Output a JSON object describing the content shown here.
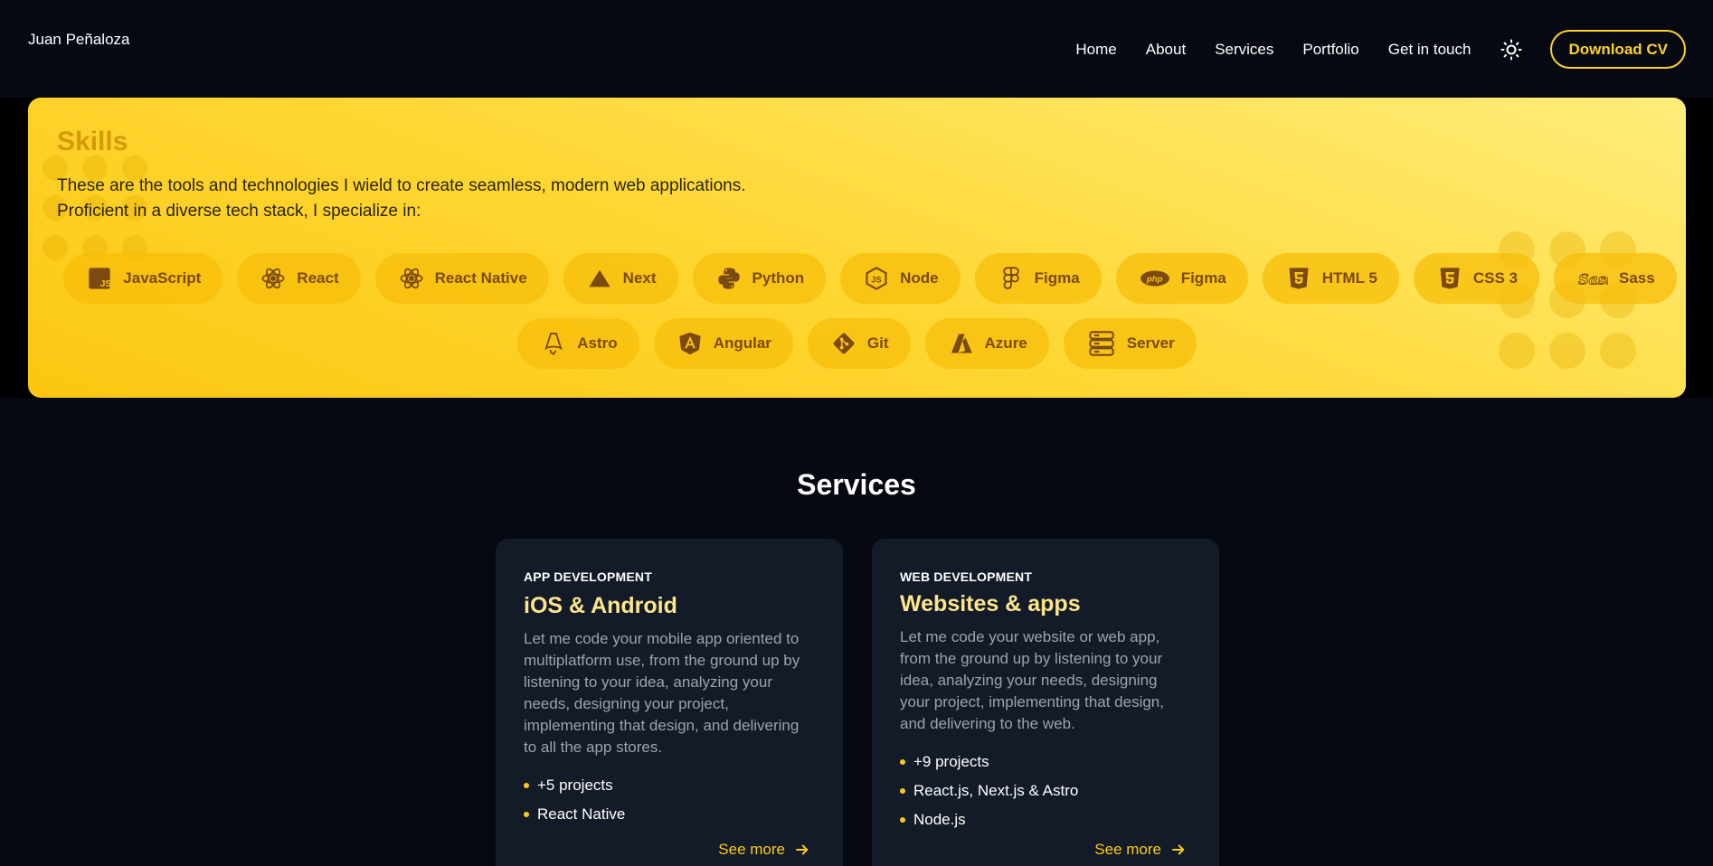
{
  "header": {
    "brand": "Juan Peñaloza",
    "nav": [
      "Home",
      "About",
      "Services",
      "Portfolio",
      "Get in touch"
    ],
    "theme_icon": "sun-icon",
    "download_cv": "Download CV",
    "accent": "#fcd12a"
  },
  "skills": {
    "title": "Skills",
    "description_line1": "These are the tools and technologies I wield to create seamless, modern web applications.",
    "description_line2": "Proficient in a diverse tech stack, I specialize in:",
    "row1": [
      {
        "label": "JavaScript",
        "icon": "javascript-icon"
      },
      {
        "label": "React",
        "icon": "react-icon"
      },
      {
        "label": "React Native",
        "icon": "react-icon"
      },
      {
        "label": "Next",
        "icon": "next-icon"
      },
      {
        "label": "Python",
        "icon": "python-icon"
      },
      {
        "label": "Node",
        "icon": "node-icon"
      },
      {
        "label": "Figma",
        "icon": "figma-icon"
      },
      {
        "label": "Figma",
        "icon": "php-icon"
      },
      {
        "label": "HTML 5",
        "icon": "html5-icon"
      },
      {
        "label": "CSS 3",
        "icon": "css3-icon"
      },
      {
        "label": "Sass",
        "icon": "sass-icon"
      }
    ],
    "row2": [
      {
        "label": "Astro",
        "icon": "astro-icon"
      },
      {
        "label": "Angular",
        "icon": "angular-icon"
      },
      {
        "label": "Git",
        "icon": "git-icon"
      },
      {
        "label": "Azure",
        "icon": "azure-icon"
      },
      {
        "label": "Server",
        "icon": "server-icon"
      }
    ]
  },
  "services": {
    "title": "Services",
    "cards": [
      {
        "kicker": "APP DEVELOPMENT",
        "title": "iOS & Android",
        "text": "Let me code your mobile app oriented to multiplatform use, from the ground up by listening to your idea, analyzing your needs, designing your project, implementing that design, and delivering to all the app stores.",
        "items": [
          "+5 projects",
          "React Native"
        ],
        "link": "See more"
      },
      {
        "kicker": "WEB DEVELOPMENT",
        "title": "Websites & apps",
        "text": "Let me code your website or web app, from the ground up by listening to your idea, analyzing your needs, designing your project, implementing that design, and delivering to the web.",
        "items": [
          "+9 projects",
          "React.js, Next.js & Astro",
          "Node.js"
        ],
        "link": "See more"
      }
    ]
  }
}
